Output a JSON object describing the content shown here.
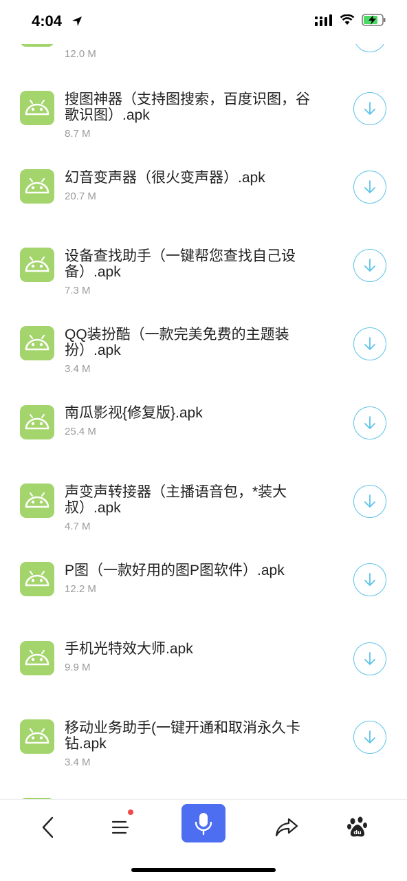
{
  "status_bar": {
    "time": "4:04"
  },
  "files": [
    {
      "name": "",
      "size": "12.0 M"
    },
    {
      "name": "搜图神器（支持图搜索，百度识图，谷歌识图）.apk",
      "size": "8.7 M"
    },
    {
      "name": "幻音变声器（很火变声器）.apk",
      "size": "20.7 M"
    },
    {
      "name": "设备查找助手（一键帮您查找自己设备）.apk",
      "size": "7.3 M"
    },
    {
      "name": "QQ装扮酷（一款完美免费的主题装扮）.apk",
      "size": "3.4 M"
    },
    {
      "name": "南瓜影视{修复版}.apk",
      "size": "25.4 M"
    },
    {
      "name": "声变声转接器（主播语音包，*装大叔）.apk",
      "size": "4.7 M"
    },
    {
      "name": "P图（一款好用的图P图软件）.apk",
      "size": "12.2 M"
    },
    {
      "name": "手机光特效大师.apk",
      "size": "9.9 M"
    },
    {
      "name": "移动业务助手(一键开通和取消永久卡钻.apk",
      "size": "3.4 M"
    }
  ],
  "colors": {
    "app_icon": "#a4d46c",
    "download": "#5cc3e8",
    "mic": "#4e6ef2",
    "badge": "#f2474a"
  },
  "icons": {
    "app": "android-icon",
    "download": "download-arrow-icon"
  }
}
